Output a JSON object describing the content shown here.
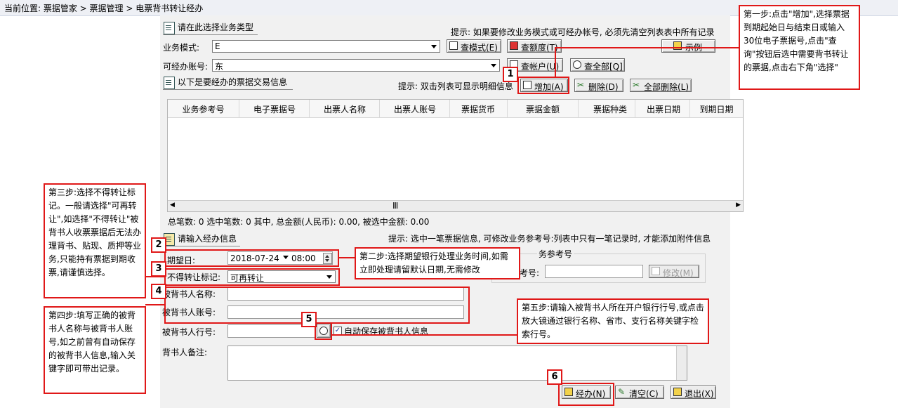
{
  "breadcrumb": "当前位置: 票据管家 > 票据管理 > 电票背书转让经办",
  "business_type": {
    "heading": "请在此选择业务类型",
    "hint": "提示: 如果要修改业务模式或可经办帐号, 必须先清空列表表中所有记录",
    "mode_label": "业务模式:",
    "mode_value": "E",
    "account_label": "可经办账号:",
    "account_value": "东",
    "btn_query_mode": "查模式(E)",
    "btn_query_quota": "查额度(T)",
    "btn_example": "示例",
    "btn_query_account": "查帐户(U)",
    "btn_query_all": "查全部[Q]"
  },
  "ticket_section": {
    "heading": "以下是要经办的票据交易信息",
    "hint": "提示: 双击列表可显示明细信息",
    "btn_add": "增加(A)",
    "btn_delete": "删除(D)",
    "btn_delete_all": "全部删除(L)",
    "columns": [
      "业务参考号",
      "电子票据号",
      "出票人名称",
      "出票人账号",
      "票据货币",
      "票据金额",
      "票据种类",
      "出票日期",
      "到期日期"
    ],
    "rows": [],
    "scroll_glyph": "Ⅲ",
    "summary": "总笔数: 0   选中笔数: 0   其中, 总金额(人民币): 0.00, 被选中金额: 0.00"
  },
  "handle_section": {
    "heading": "请输入经办信息",
    "hint": "提示: 选中一笔票据信息, 可修改业务参考号:列表中只有一笔记录时, 才能添加附件信息",
    "expect_date_label": "期望日:",
    "expect_date": "2018-07-24",
    "expect_time": "08:00",
    "nontransfer_label": "不得转让标记:",
    "nontransfer_value": "可再转让",
    "endorsee_name_label": "被背书人名称:",
    "endorsee_account_label": "被背书人账号:",
    "endorsee_bank_label": "被背书人行号:",
    "autosave_label": "自动保存被背书人信息",
    "autosave_checked": "✓",
    "remark_label": "背书人备注:",
    "ref_group_label": "务参考号",
    "ref_field_label": "考号:",
    "btn_modify": "修改(M)",
    "btn_handle": "经办(N)",
    "btn_clear": "清空(C)",
    "btn_exit": "退出(X)"
  },
  "annotations": {
    "step1": "第一步:点击\"增加\",选择票据到期起始日与结束日或输入30位电子票据号,点击\"查询\"按钮后选中需要背书转让的票据,点击右下角\"选择\"",
    "step2": "第二步:选择期望银行处理业务时间,如需立即处理请留默认日期,无需修改",
    "step3": "第三步:选择不得转让标记。一般请选择\"可再转让\",如选择\"不得转让\"被背书人收票票据后无法办理背书、贴现、质押等业务,只能持有票据到期收票,请谨慎选择。",
    "step4": "第四步:填写正确的被背书人名称与被背书人账号,如之前曾有自动保存的被背书人信息,输入关键字即可带出记录。",
    "step5": "第五步:请输入被背书人所在开户银行行号,或点击放大镜通过银行名称、省市、支行名称关键字检索行号。",
    "n1": "1",
    "n2": "2",
    "n3": "3",
    "n4": "4",
    "n5": "5",
    "n6": "6"
  }
}
